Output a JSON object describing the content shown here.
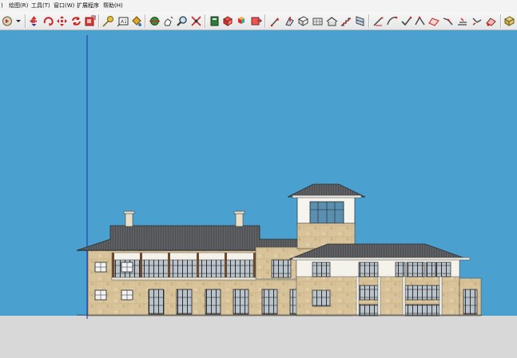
{
  "menu": {
    "items": [
      "绘图(R)",
      "工具(T)",
      "窗口(W)",
      "扩展程序",
      "帮助(H)"
    ]
  },
  "toolbar": {
    "tools": [
      "select-tool",
      "paint-bucket-tool",
      "move-tool",
      "rotate-tool",
      "scale-tool",
      "push-pull-tool",
      "follow-me-tool",
      "tape-measure-tool",
      "dimension-tool",
      "text-tool",
      "orbit-tool",
      "pan-tool",
      "zoom-tool",
      "zoom-extents-tool",
      "components-tool",
      "materials-tool",
      "styles-tool",
      "layers-tool",
      "section-tool",
      "face-tool",
      "wall-tool",
      "roof-tool",
      "stairs-tool",
      "window-tool",
      "column-tool",
      "door-tool",
      "beam-tool",
      "edit-tool",
      "arc-tool",
      "curve-tool",
      "trim-tool",
      "offset-tool",
      "extend-tool",
      "smooth-tool",
      "export-tool"
    ]
  },
  "colors": {
    "sky": "#4aa1cf",
    "ground": "#d8d8d8",
    "roof": "#5d5f62",
    "stone": "#d9c49b",
    "axis": "#1b2fa8"
  }
}
